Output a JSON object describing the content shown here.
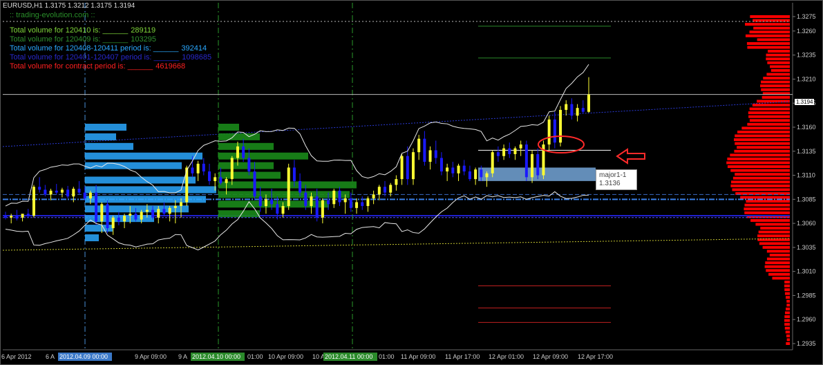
{
  "header": {
    "symbol_line": "EURUSD,H1  1.3175 1.3212 1.3175 1.3194",
    "site": ":: trading-evolution.com ::"
  },
  "volume_lines": [
    {
      "label": "Total volume for 120410 is: ______",
      "value": "289119",
      "color": "#7fd63a"
    },
    {
      "label": "Total volume for 120409 is: ______",
      "value": "103295",
      "color": "#2f8f2f"
    },
    {
      "label": "Total volume for 120408-120411 period is: ______",
      "value": "392414",
      "color": "#2aa8ff"
    },
    {
      "label": "Total volume for 120401-120407 period is: ______",
      "value": "1098685",
      "color": "#2828cc"
    },
    {
      "label": "Total volume for contract period is: ______",
      "value": "4619668",
      "color": "#ff2020"
    }
  ],
  "tooltip": {
    "name": "major1-1",
    "value": "1.3136"
  },
  "price_tag": "1.3194",
  "chart_data": {
    "type": "candlestick",
    "y_axis": {
      "min": 1.2935,
      "max": 1.3275,
      "ticks": [
        "1.3275",
        "1.3260",
        "1.3235",
        "1.3210",
        "1.3185",
        "1.3160",
        "1.3135",
        "1.3110",
        "1.3085",
        "1.3060",
        "1.3035",
        "1.3010",
        "1.2985",
        "1.2960",
        "1.2935"
      ]
    },
    "x_axis": {
      "labels": [
        "6 Apr 2012",
        "6 A",
        "9 Apr 09:00",
        "9 A",
        "01:00",
        "10 Apr 09:00",
        "10 A",
        "01:00",
        "11 Apr 09:00",
        "11 Apr 17:00",
        "12 Apr 01:00",
        "12 Apr 09:00",
        "12 Apr 17:00"
      ],
      "highlighted_labels": [
        "2012.04.09 00:00",
        "2012.04.10 00:00",
        "2012.04.11 00:00"
      ]
    },
    "candles": [
      [
        1.3068,
        1.3072,
        1.3064,
        1.3066
      ],
      [
        1.3066,
        1.307,
        1.306,
        1.3068
      ],
      [
        1.3068,
        1.3074,
        1.3063,
        1.3065
      ],
      [
        1.3066,
        1.3069,
        1.3062,
        1.307
      ],
      [
        1.307,
        1.3075,
        1.3066,
        1.3068
      ],
      [
        1.3068,
        1.31,
        1.3066,
        1.3098
      ],
      [
        1.3098,
        1.3108,
        1.3092,
        1.3095
      ],
      [
        1.3095,
        1.31,
        1.3088,
        1.309
      ],
      [
        1.309,
        1.3096,
        1.3084,
        1.3094
      ],
      [
        1.3094,
        1.3101,
        1.309,
        1.3092
      ],
      [
        1.3092,
        1.3097,
        1.3087,
        1.3095
      ],
      [
        1.3095,
        1.3099,
        1.3086,
        1.3088
      ],
      [
        1.3088,
        1.3098,
        1.3082,
        1.3096
      ],
      [
        1.3096,
        1.3104,
        1.309,
        1.3092
      ],
      [
        1.3092,
        1.3098,
        1.3084,
        1.3086
      ],
      [
        1.3086,
        1.3094,
        1.308,
        1.3092
      ],
      [
        1.3092,
        1.31,
        1.3058,
        1.3062
      ],
      [
        1.3062,
        1.3082,
        1.305,
        1.308
      ],
      [
        1.308,
        1.3084,
        1.305,
        1.3055
      ],
      [
        1.3055,
        1.3068,
        1.3048,
        1.3066
      ],
      [
        1.3066,
        1.3072,
        1.3058,
        1.3062
      ],
      [
        1.3062,
        1.307,
        1.3055,
        1.3068
      ],
      [
        1.3068,
        1.3078,
        1.306,
        1.307
      ],
      [
        1.307,
        1.3076,
        1.3062,
        1.3064
      ],
      [
        1.3064,
        1.3074,
        1.306,
        1.3072
      ],
      [
        1.3072,
        1.308,
        1.3066,
        1.3074
      ],
      [
        1.3074,
        1.3078,
        1.3064,
        1.3066
      ],
      [
        1.3066,
        1.3078,
        1.306,
        1.3075
      ],
      [
        1.3075,
        1.3082,
        1.3068,
        1.307
      ],
      [
        1.307,
        1.3078,
        1.3062,
        1.3076
      ],
      [
        1.3076,
        1.3084,
        1.306,
        1.3078
      ],
      [
        1.3078,
        1.3086,
        1.3066,
        1.3082
      ],
      [
        1.3082,
        1.312,
        1.3078,
        1.3118
      ],
      [
        1.3118,
        1.313,
        1.3108,
        1.3112
      ],
      [
        1.3112,
        1.3125,
        1.3104,
        1.3122
      ],
      [
        1.3122,
        1.3128,
        1.311,
        1.3114
      ],
      [
        1.3114,
        1.3122,
        1.31,
        1.3104
      ],
      [
        1.3104,
        1.3112,
        1.3094,
        1.3108
      ],
      [
        1.3108,
        1.3118,
        1.31,
        1.3102
      ],
      [
        1.3102,
        1.3108,
        1.309,
        1.3106
      ],
      [
        1.3106,
        1.313,
        1.31,
        1.3128
      ],
      [
        1.3128,
        1.3145,
        1.312,
        1.314
      ],
      [
        1.314,
        1.3148,
        1.3124,
        1.3128
      ],
      [
        1.3128,
        1.3138,
        1.311,
        1.3114
      ],
      [
        1.3114,
        1.3124,
        1.3084,
        1.3088
      ],
      [
        1.3088,
        1.3098,
        1.3072,
        1.3078
      ],
      [
        1.3078,
        1.309,
        1.307,
        1.3085
      ],
      [
        1.3085,
        1.3096,
        1.3074,
        1.308
      ],
      [
        1.308,
        1.3088,
        1.3064,
        1.307
      ],
      [
        1.307,
        1.3082,
        1.3066,
        1.3078
      ],
      [
        1.3078,
        1.3122,
        1.3074,
        1.3118
      ],
      [
        1.3118,
        1.3126,
        1.3098,
        1.3104
      ],
      [
        1.3104,
        1.3112,
        1.3088,
        1.3092
      ],
      [
        1.3092,
        1.31,
        1.3074,
        1.3078
      ],
      [
        1.3078,
        1.3092,
        1.307,
        1.3088
      ],
      [
        1.3088,
        1.3096,
        1.3062,
        1.3066
      ],
      [
        1.3066,
        1.3086,
        1.306,
        1.3084
      ],
      [
        1.3084,
        1.3092,
        1.3074,
        1.308
      ],
      [
        1.308,
        1.3096,
        1.3076,
        1.3094
      ],
      [
        1.3094,
        1.3098,
        1.3078,
        1.3082
      ],
      [
        1.3082,
        1.309,
        1.307,
        1.3086
      ],
      [
        1.3086,
        1.3092,
        1.3072,
        1.3076
      ],
      [
        1.3076,
        1.3086,
        1.307,
        1.3082
      ],
      [
        1.3082,
        1.3088,
        1.3074,
        1.3078
      ],
      [
        1.3078,
        1.3088,
        1.3072,
        1.3086
      ],
      [
        1.3086,
        1.3094,
        1.308,
        1.309
      ],
      [
        1.309,
        1.31,
        1.3084,
        1.3098
      ],
      [
        1.3098,
        1.3104,
        1.3088,
        1.3092
      ],
      [
        1.3092,
        1.3102,
        1.3088,
        1.31
      ],
      [
        1.31,
        1.311,
        1.3094,
        1.3106
      ],
      [
        1.3106,
        1.3132,
        1.31,
        1.313
      ],
      [
        1.313,
        1.314,
        1.31,
        1.3106
      ],
      [
        1.3106,
        1.3138,
        1.31,
        1.3134
      ],
      [
        1.3134,
        1.3152,
        1.3126,
        1.3148
      ],
      [
        1.3148,
        1.3156,
        1.312,
        1.3124
      ],
      [
        1.3124,
        1.314,
        1.3116,
        1.3136
      ],
      [
        1.3136,
        1.3146,
        1.3122,
        1.3128
      ],
      [
        1.3128,
        1.3134,
        1.311,
        1.3114
      ],
      [
        1.3114,
        1.3122,
        1.3104,
        1.3118
      ],
      [
        1.3118,
        1.3124,
        1.3108,
        1.3112
      ],
      [
        1.3112,
        1.3122,
        1.3104,
        1.312
      ],
      [
        1.312,
        1.3126,
        1.311,
        1.3114
      ],
      [
        1.3114,
        1.312,
        1.3104,
        1.3106
      ],
      [
        1.3106,
        1.3118,
        1.31,
        1.3116
      ],
      [
        1.3116,
        1.312,
        1.3104,
        1.3108
      ],
      [
        1.3108,
        1.3114,
        1.3098,
        1.3112
      ],
      [
        1.3112,
        1.3136,
        1.3108,
        1.3134
      ],
      [
        1.3134,
        1.314,
        1.3124,
        1.313
      ],
      [
        1.313,
        1.3142,
        1.3126,
        1.3138
      ],
      [
        1.3138,
        1.3144,
        1.3128,
        1.3132
      ],
      [
        1.3132,
        1.314,
        1.3126,
        1.3138
      ],
      [
        1.3138,
        1.3146,
        1.313,
        1.3142
      ],
      [
        1.3142,
        1.3146,
        1.3104,
        1.3108
      ],
      [
        1.3108,
        1.3136,
        1.3102,
        1.3132
      ],
      [
        1.3132,
        1.3138,
        1.3106,
        1.311
      ],
      [
        1.311,
        1.3146,
        1.3106,
        1.3142
      ],
      [
        1.3142,
        1.3172,
        1.3136,
        1.3168
      ],
      [
        1.3168,
        1.3176,
        1.3138,
        1.3144
      ],
      [
        1.3144,
        1.3182,
        1.314,
        1.3178
      ],
      [
        1.3178,
        1.3188,
        1.3172,
        1.3184
      ],
      [
        1.3184,
        1.319,
        1.3168,
        1.3172
      ],
      [
        1.3172,
        1.3184,
        1.3166,
        1.318
      ],
      [
        1.318,
        1.3188,
        1.3174,
        1.3176
      ],
      [
        1.3176,
        1.3212,
        1.3175,
        1.3194
      ]
    ],
    "levels": [
      {
        "price": 1.3265,
        "color": "#2a8a2a"
      },
      {
        "price": 1.3232,
        "color": "#2a8a2a"
      },
      {
        "price": 1.2995,
        "color": "#c02020"
      },
      {
        "price": 1.2972,
        "color": "#c02020"
      },
      {
        "price": 1.2957,
        "color": "#c02020"
      },
      {
        "price": 1.3136,
        "color": "#ffffff"
      }
    ],
    "current_price": 1.3194,
    "colors": {
      "bull": "#ffff33",
      "bear": "#1a1aff",
      "profile": "#ff0000",
      "green_profile": "#1a8a1a",
      "blue_profile": "#2aa8ff"
    }
  }
}
